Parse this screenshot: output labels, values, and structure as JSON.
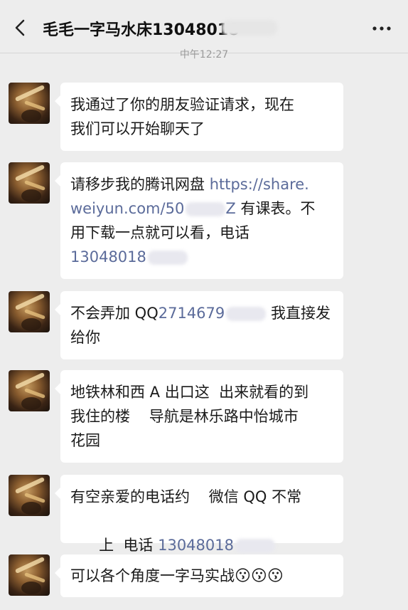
{
  "header": {
    "title": "毛毛一字马水床13048018",
    "timestamp": "中午12:27"
  },
  "messages": [
    {
      "line1": "我通过了你的朋友验证请求，现在",
      "line2": "我们可以开始聊天了"
    },
    {
      "pre": "请移步我的腾讯网盘 ",
      "link1": "https://share.",
      "link2": "weiyun.com/50",
      "link3": "Z",
      "post1": " 有课表。不",
      "line3": "用下载一点就可以看，电话",
      "phone": "13048018"
    },
    {
      "pre": "不会弄加 QQ",
      "qq": "2714679",
      "post": " 我直接发",
      "line2": "给你"
    },
    {
      "line1": "地铁林和西 A 出口这  出来就看的到",
      "line2": "我住的楼    导航是林乐路中怡城市",
      "line3": "花园"
    },
    {
      "line1": "有空亲爱的电话约    微信 QQ 不常",
      "pre2": "上  电话 ",
      "phone": "13048018"
    },
    {
      "text": "可以各个角度一字马实战",
      "emoji": "😗😗😗"
    }
  ]
}
